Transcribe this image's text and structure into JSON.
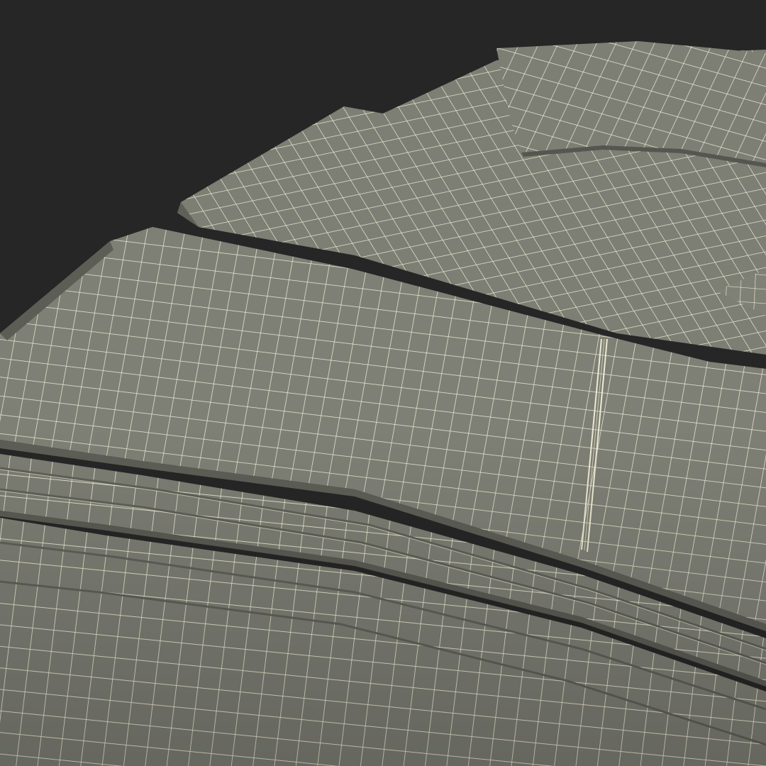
{
  "scene": {
    "subject": "stack-of-wireframe-paper-sheets",
    "colors": {
      "background": "#262626",
      "sheet_fill": "#7d7e74",
      "sheet_fill_light": "#888980",
      "sheet_shadow": "#5f6058",
      "wire": "#ecead2"
    }
  }
}
